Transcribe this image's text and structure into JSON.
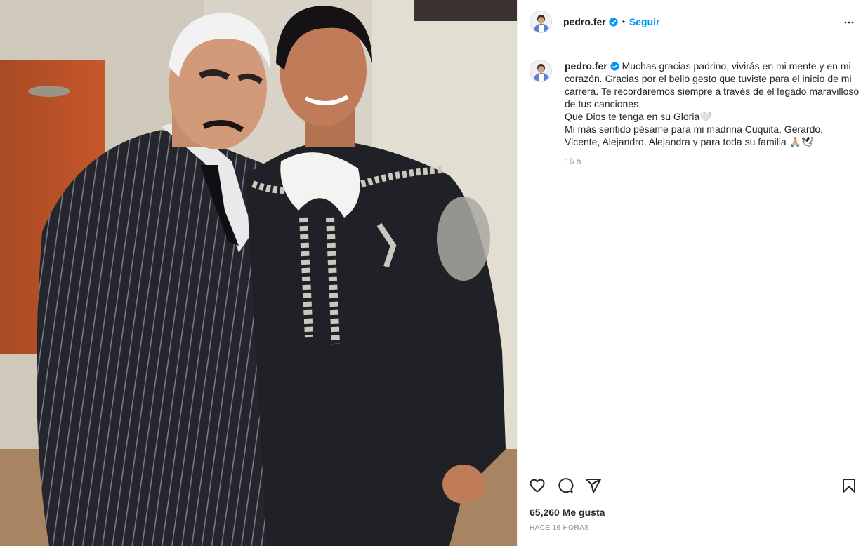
{
  "photo": {
    "description_icon": "post-photo"
  },
  "header": {
    "username": "pedro.fer",
    "dot": "•",
    "follow_label": "Seguir",
    "more_icon": "more-options-icon"
  },
  "caption": {
    "username": "pedro.fer",
    "text": "Muchas gracias padrino, vivirás en mi mente y en mi corazón. Gracias por el bello gesto que tuviste para el inicio de mi carrera. Te recordaremos siempre a través de el legado maravilloso de tus canciones.\nQue Dios te tenga en su Gloria🤍\nMi más sentido pésame para mi madrina Cuquita, Gerardo, Vicente, Alejandro, Alejandra y para toda su familia 🙏🏼🕊",
    "time": "16 h"
  },
  "actions": {
    "like_icon": "heart-icon",
    "comment_icon": "comment-icon",
    "share_icon": "share-icon",
    "save_icon": "bookmark-icon",
    "likes": "65,260 Me gusta",
    "date": "HACE 16 HORAS"
  },
  "colors": {
    "accent": "#0095f6",
    "verified": "#0095f6",
    "text": "#262626",
    "muted": "#8e8e8e",
    "border": "#efefef"
  }
}
